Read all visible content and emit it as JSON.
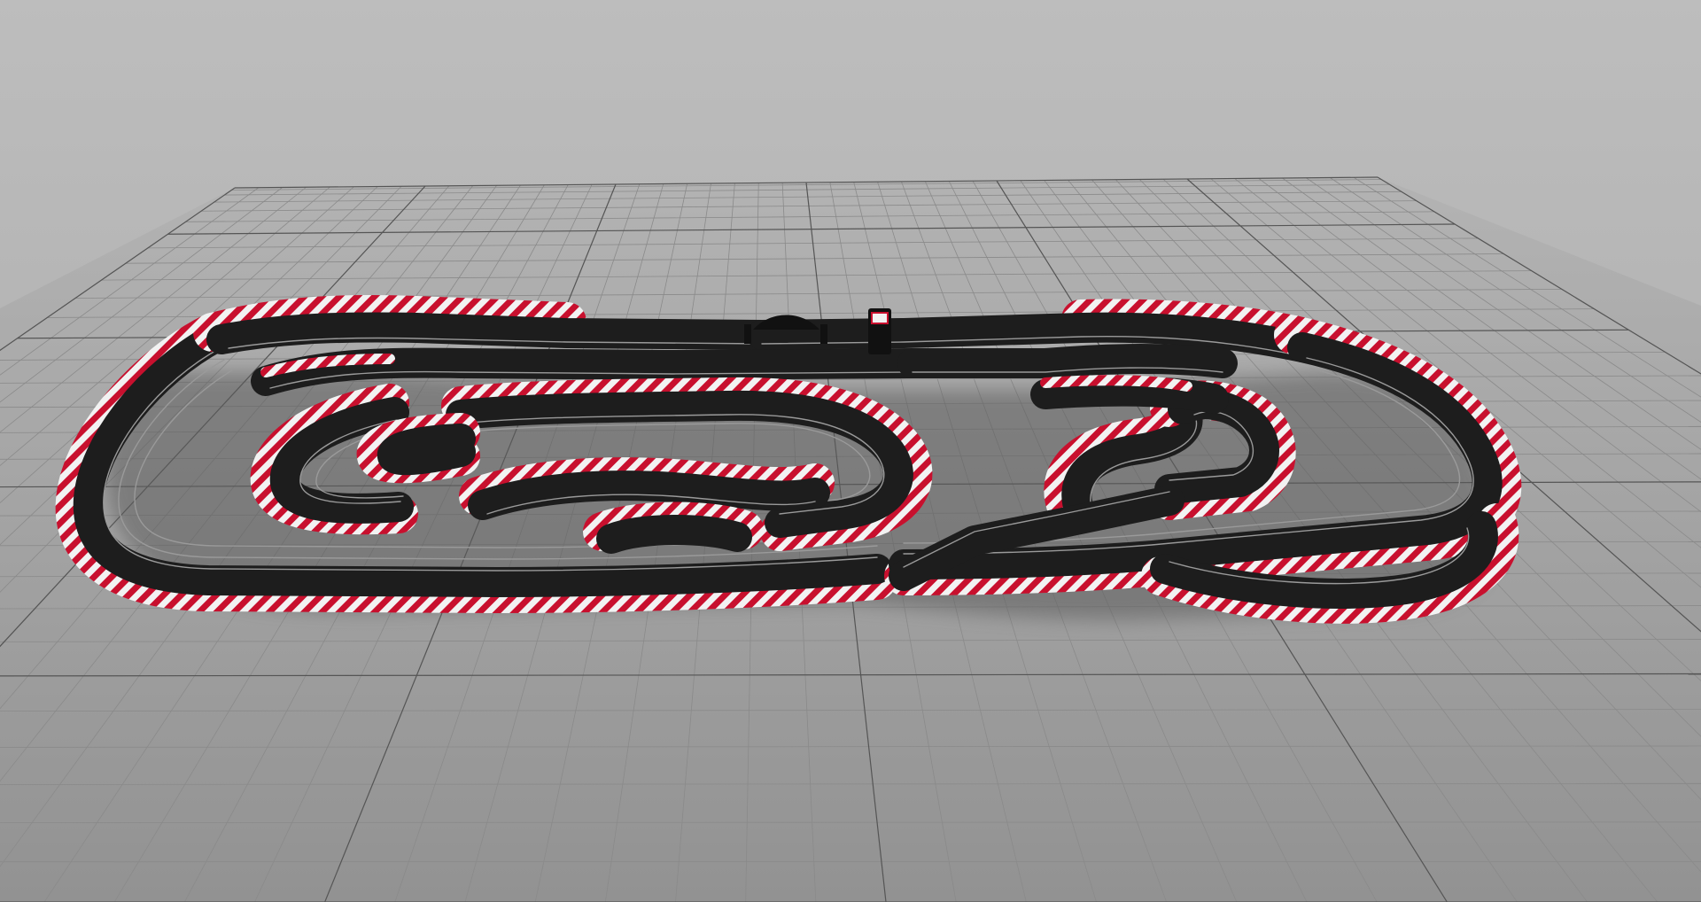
{
  "app": {
    "view": "3d-track-planner-viewport"
  },
  "scene": {
    "colors": {
      "sky_top": "#bdbdbd",
      "sky_bottom": "#a7a7a7",
      "floor_near": "#929292",
      "floor_far": "#b3b3b3",
      "grid_minor": "#8a8a8a",
      "grid_major": "#555555",
      "track_surface": "#1d1d1d",
      "track_edge": "#111111",
      "lane_line": "#9a9a9a",
      "lane_dash": "#d8d8d8",
      "curb_red": "#c8102e",
      "curb_white": "#f2f2f2",
      "shadow": "#5c5c5c"
    },
    "icons": {
      "start_gantry": "start-finish-gantry-icon",
      "lap_counter": "lap-counter-tower-icon"
    }
  }
}
